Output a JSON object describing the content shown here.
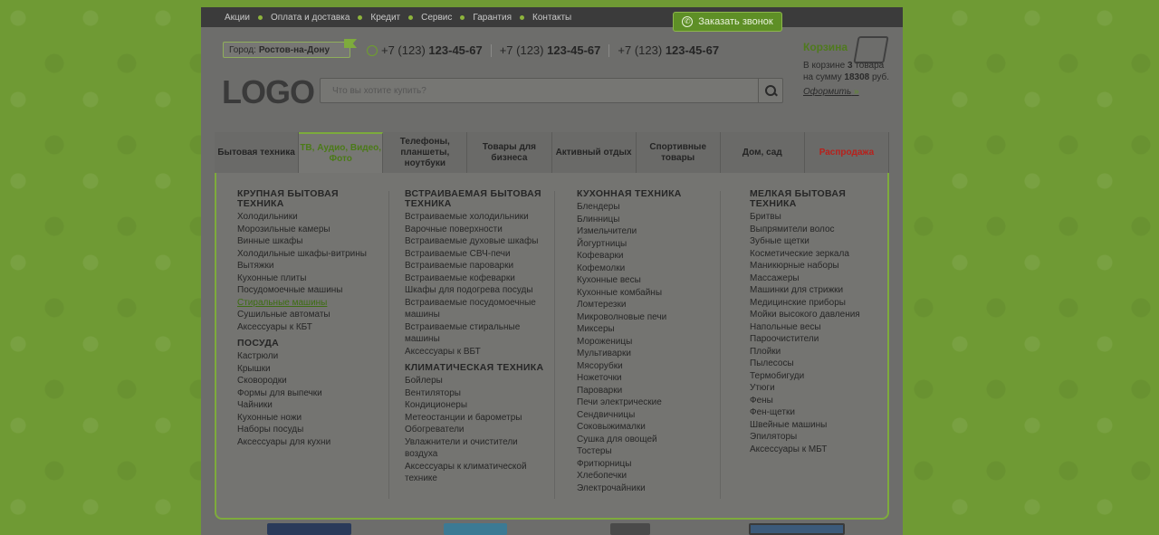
{
  "topbar": {
    "items": [
      "Акции",
      "Оплата и доставка",
      "Кредит",
      "Сервис",
      "Гарантия",
      "Контакты"
    ]
  },
  "callback_button": "Заказать звонок",
  "city": {
    "label": "Город:",
    "value": "Ростов-на-Дону"
  },
  "phones": [
    {
      "prefix": "+7 (123)",
      "number": "123-45-67"
    },
    {
      "prefix": "+7 (123)",
      "number": "123-45-67"
    },
    {
      "prefix": "+7 (123)",
      "number": "123-45-67"
    }
  ],
  "cart": {
    "title": "Корзина",
    "line1_pre": "В корзине ",
    "count": "3",
    "line1_post": " товара",
    "line2_pre": "на сумму ",
    "sum": "18308",
    "line2_post": " руб.",
    "checkout": "Оформить",
    "checkout_arrow": "»"
  },
  "logo": "LOGO",
  "search": {
    "placeholder": "Что вы хотите купить?"
  },
  "nav": {
    "tabs": [
      "Бытовая техника",
      "ТВ, Аудио, Видео, Фото",
      "Телефоны, планшеты, ноутбуки",
      "Товары для бизнеса",
      "Активный отдых",
      "Спортивные товары",
      "Дом, сад",
      "Распродажа"
    ]
  },
  "menu": {
    "col1": {
      "h1": "КРУПНАЯ БЫТОВАЯ ТЕХНИКА",
      "items1": [
        "Холодильники",
        "Морозильные камеры",
        "Винные шкафы",
        "Холодильные шкафы-витрины",
        "Вытяжки",
        "Кухонные плиты",
        "Посудомоечные машины",
        "Стиральные машины",
        "Сушильные автоматы",
        "Аксессуары к КБТ"
      ],
      "h2": "ПОСУДА",
      "items2": [
        "Кастрюли",
        "Крышки",
        "Сковородки",
        "Формы для выпечки",
        "Чайники",
        "Кухонные ножи",
        "Наборы посуды",
        "Аксессуары для кухни"
      ]
    },
    "col2": {
      "h1": "ВСТРАИВАЕМАЯ БЫТОВАЯ ТЕХНИКА",
      "items1": [
        "Встраиваемые холодильники",
        "Варочные поверхности",
        "Встраиваемые духовые шкафы",
        "Встраиваемые СВЧ-печи",
        "Встраиваемые пароварки",
        "Встраиваемые кофеварки",
        "Шкафы для подогрева посуды",
        "Встраиваемые посудомоечные машины",
        "Встраиваемые стиральные машины",
        "Аксессуары к ВБТ"
      ],
      "h2": "КЛИМАТИЧЕСКАЯ ТЕХНИКА",
      "items2": [
        "Бойлеры",
        "Вентиляторы",
        "Кондиционеры",
        "Метеостанции и барометры",
        "Обогреватели",
        "Увлажнители и очистители воздуха",
        "Аксессуары к климатической технике"
      ]
    },
    "col3": {
      "h1": "КУХОННАЯ ТЕХНИКА",
      "items1": [
        "Блендеры",
        "Блинницы",
        "Измельчители",
        "Йогуртницы",
        "Кофеварки",
        "Кофемолки",
        "Кухонные весы",
        "Кухонные комбайны",
        "Ломтерезки",
        "Микроволновые печи",
        "Миксеры",
        "Мороженицы",
        "Мультиварки",
        "Мясорубки",
        "Ножеточки",
        "Пароварки",
        "Печи электрические",
        "Сендвичницы",
        "Соковыжималки",
        "Сушка для овощей",
        "Тостеры",
        "Фритюрницы",
        "Хлебопечки",
        "Электрочайники"
      ]
    },
    "col4": {
      "h1": "МЕЛКАЯ БЫТОВАЯ ТЕХНИКА",
      "items1": [
        "Бритвы",
        "Выпрямители волос",
        "Зубные щетки",
        "Косметические зеркала",
        "Маникюрные наборы",
        "Массажеры",
        "Машинки для стрижки",
        "Медицинские приборы",
        "Мойки высокого давления",
        "Напольные весы",
        "Пароочистители",
        "Плойки",
        "Пылесосы",
        "Термобигуди",
        "Утюги",
        "Фены",
        "Фен-щетки",
        "Швейные машины",
        "Эпиляторы",
        "Аксессуары к МБТ"
      ]
    }
  },
  "colors": {
    "accent": "#7cab3c",
    "sale": "#b8201b",
    "background": "#6f9a34"
  }
}
